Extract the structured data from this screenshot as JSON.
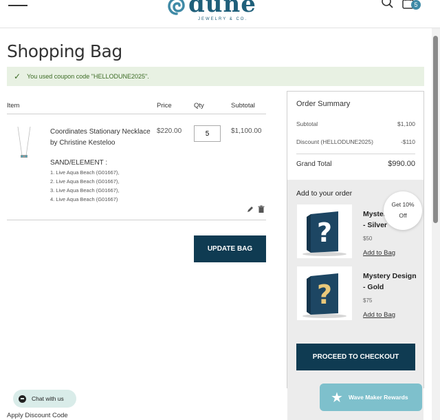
{
  "header": {
    "brand": "dune",
    "brand_sub": "JEWELRY & CO.",
    "cart_count": "5"
  },
  "page": {
    "title": "Shopping Bag"
  },
  "coupon_notice": "You used coupon code \"HELLODUNE2025\".",
  "cart": {
    "columns": [
      "Item",
      "Price",
      "Qty",
      "Subtotal"
    ],
    "item": {
      "name": "Coordinates Stationary Necklace by Christine Kesteloo",
      "price": "$220.00",
      "qty": "5",
      "subtotal": "$1,100.00",
      "option_title": "SAND/ELEMENT :",
      "options": [
        "1. Live Aqua Beach (G01667),",
        "2. Live Aqua Beach (G01667),",
        "3. Live Aqua Beach (G01667),",
        "4. Live Aqua Beach (G01667)"
      ]
    },
    "update_label": "UPDATE BAG"
  },
  "summary": {
    "title": "Order Summary",
    "subtotal_label": "Subtotal",
    "subtotal_value": "$1,100",
    "discount_label": "Discount (HELLODUNE2025)",
    "discount_value": "-$110",
    "grand_label": "Grand Total",
    "grand_value": "$990.00",
    "addon_title": "Add to your order",
    "products": [
      {
        "name_line1": "Mystery",
        "name_line2": "- Silver",
        "price": "$50",
        "link": "Add to Bag",
        "mark_color": "#ffffff"
      },
      {
        "name_line1": "Mystery Design",
        "name_line2": "- Gold",
        "price": "$75",
        "link": "Add to Bag",
        "mark_color": "#e9c87a"
      }
    ],
    "checkout_label": "PROCEED TO CHECKOUT"
  },
  "discount_badge": {
    "line1": "Get 10%",
    "line2": "Off"
  },
  "chat_label": "Chat with us",
  "apply_discount_label": "Apply Discount Code",
  "rewards_label": "Wave Maker Rewards",
  "colors": {
    "primary_button": "#0f3b52",
    "brand": "#1f5f7a",
    "success_bg": "#e8f1e3",
    "rewards": "#7ec0cc"
  }
}
